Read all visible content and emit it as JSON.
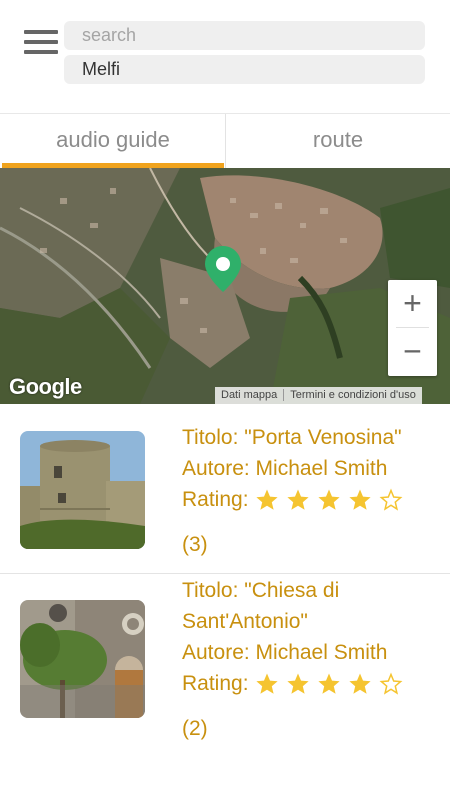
{
  "search": {
    "placeholder": "search"
  },
  "location": {
    "value": "Melfi"
  },
  "tabs": [
    {
      "label": "audio guide"
    },
    {
      "label": "route"
    }
  ],
  "map": {
    "logo": "Google",
    "footer_data": "Dati mappa",
    "footer_terms": "Termini e condizioni d'uso",
    "zoom_in": "+",
    "zoom_out": "−"
  },
  "items": [
    {
      "title": "Titolo: \"Porta Venosina\"",
      "author": "Autore: Michael Smith",
      "rating_label": "Rating:",
      "rating_value": 4,
      "rating_max": 5,
      "count": "(3)"
    },
    {
      "title_line1": "Titolo: \"Chiesa di",
      "title_line2": "Sant'Antonio\"",
      "author": "Autore: Michael Smith",
      "rating_label": "Rating:",
      "rating_value": 4,
      "rating_max": 5,
      "count": "(2)"
    }
  ],
  "colors": {
    "accent": "#f0a31d",
    "text_gold": "#c8900f",
    "star": "#f5c430"
  },
  "icons": [
    "menu-icon",
    "map-pin-icon",
    "star-icon",
    "star-outline-icon"
  ]
}
